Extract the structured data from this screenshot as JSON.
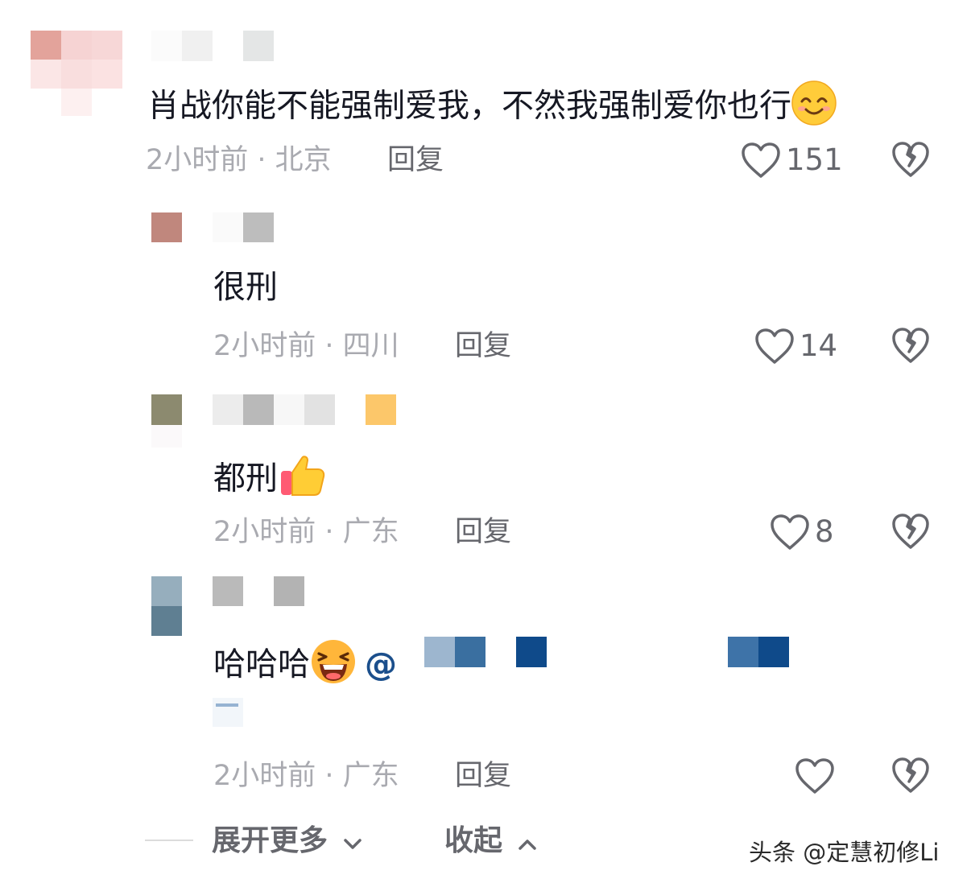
{
  "comments": [
    {
      "text": "肖战你能不能强制爱我，不然我强制爱你也行",
      "time_location": "2小时前 · 北京",
      "reply_label": "回复",
      "like_count": "151",
      "emoji": "smile-emoji"
    },
    {
      "text": "很刑",
      "time_location": "2小时前 · 四川",
      "reply_label": "回复",
      "like_count": "14"
    },
    {
      "text": "都刑",
      "time_location": "2小时前 · 广东",
      "reply_label": "回复",
      "like_count": "8",
      "emoji": "thumbs-up-emoji"
    },
    {
      "text": "哈哈哈",
      "mention_prefix": "@",
      "time_location": "2小时前 · 广东",
      "reply_label": "回复",
      "like_count": "",
      "emoji": "laughing-emoji"
    }
  ],
  "footer": {
    "expand_label": "展开更多",
    "collapse_label": "收起"
  },
  "watermark": "头条 @定慧初修Li",
  "colors": {
    "meta_gray": "#a9aab0",
    "action_gray": "#66676d",
    "text": "#161823",
    "mention_blue": "#1b4f8c"
  }
}
